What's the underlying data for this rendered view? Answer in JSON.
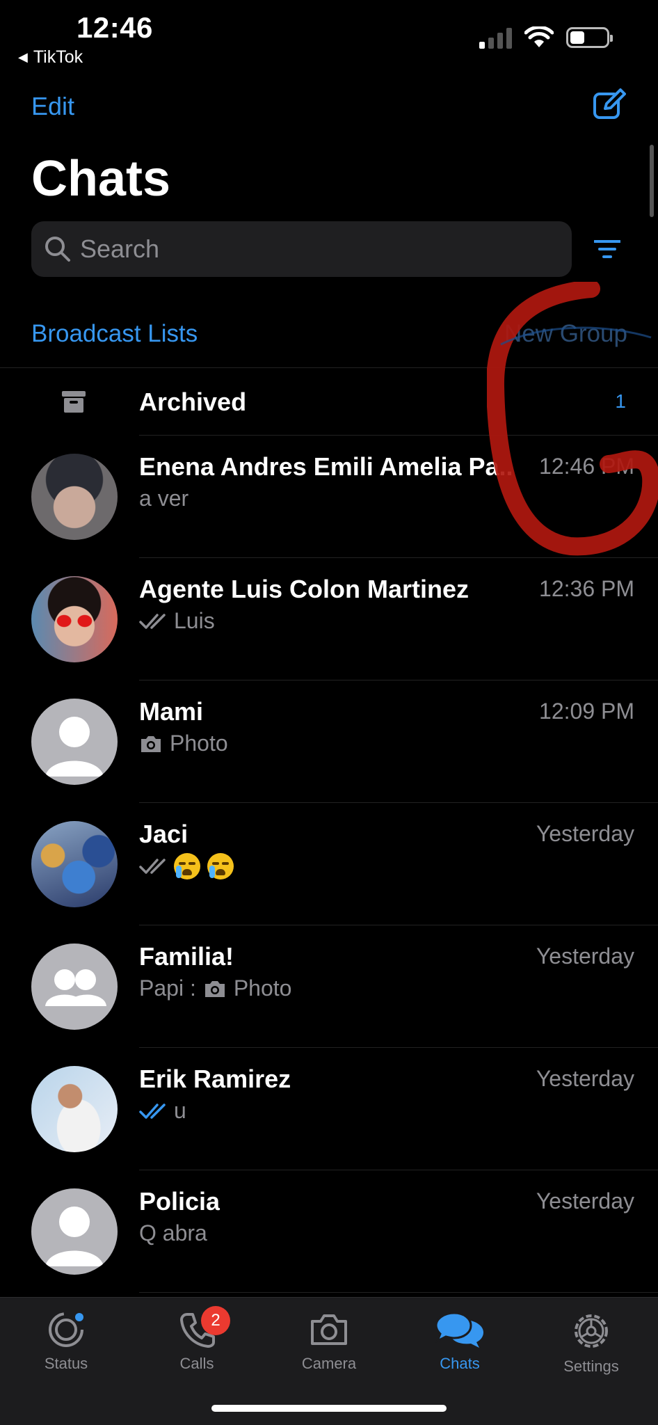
{
  "status_bar": {
    "time": "12:46",
    "back_app": "TikTok"
  },
  "header": {
    "edit_label": "Edit",
    "title": "Chats",
    "search_placeholder": "Search",
    "broadcast_label": "Broadcast Lists",
    "new_group_label": "New Group"
  },
  "archived": {
    "label": "Archived",
    "count": "1"
  },
  "chats": [
    {
      "name": "Enena Andres Emili Amelia Pa..",
      "time": "12:46 PM",
      "preview": "a ver",
      "avatar": "photo-dark"
    },
    {
      "name": "Agente Luis Colon Martinez",
      "time": "12:36 PM",
      "preview": "Luis",
      "avatar": "photo-red"
    },
    {
      "name": "Mami",
      "time": "12:09 PM",
      "preview": "Photo",
      "avatar": "default-user"
    },
    {
      "name": "Jaci",
      "time": "Yesterday",
      "preview": "",
      "avatar": "photo-blue"
    },
    {
      "name": "Familia!",
      "time": "Yesterday",
      "preview_sender": "Papi :",
      "preview": "Photo",
      "avatar": "default-group"
    },
    {
      "name": "Erik Ramirez",
      "time": "Yesterday",
      "preview": "u",
      "avatar": "photo-light"
    },
    {
      "name": "Policia",
      "time": "Yesterday",
      "preview": "Q abra",
      "avatar": "default-user"
    }
  ],
  "tabs": [
    {
      "label": "Status",
      "icon": "status-icon"
    },
    {
      "label": "Calls",
      "icon": "phone-icon",
      "badge": "2"
    },
    {
      "label": "Camera",
      "icon": "camera-icon"
    },
    {
      "label": "Chats",
      "icon": "chat-bubbles-icon",
      "active": true
    },
    {
      "label": "Settings",
      "icon": "gear-icon"
    }
  ],
  "colors": {
    "accent": "#3797f0",
    "background": "#000000",
    "secondary_text": "#8e8e93",
    "badge": "#eb3a30",
    "annotation": "#b0180f"
  }
}
